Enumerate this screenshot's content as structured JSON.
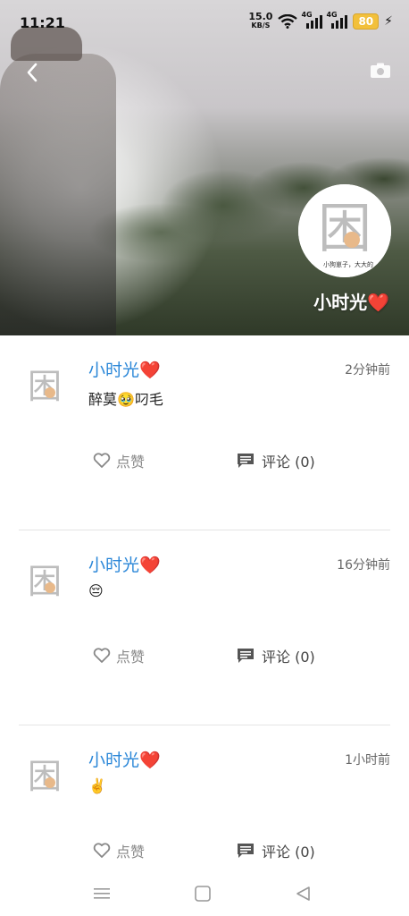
{
  "status_bar": {
    "time": "11:21",
    "net_speed": "15.0",
    "net_unit": "KB/S",
    "signal_1_label": "4G",
    "signal_2_label": "4G",
    "battery": "80"
  },
  "profile": {
    "name": "小时光❤️",
    "avatar_glyph": "困",
    "avatar_caption": "小狗崽子，大大的"
  },
  "posts": [
    {
      "name": "小时光❤️",
      "time": "2分钟前",
      "text": "醉莫🥹叼毛",
      "like_label": "点赞",
      "comment_label": "评论 (0)"
    },
    {
      "name": "小时光❤️",
      "time": "16分钟前",
      "text": "😔",
      "like_label": "点赞",
      "comment_label": "评论 (0)"
    },
    {
      "name": "小时光❤️",
      "time": "1小时前",
      "text": "✌️",
      "like_label": "点赞",
      "comment_label": "评论 (0)"
    }
  ],
  "icons": {
    "back": "back-arrow-icon",
    "camera": "camera-icon",
    "like": "heart-outline-icon",
    "comment": "comment-icon",
    "nav_menu": "menu-icon",
    "nav_home": "square-home-icon",
    "nav_back": "triangle-back-icon"
  },
  "colors": {
    "name_blue": "#2b87d8",
    "battery": "#f2c03b"
  }
}
